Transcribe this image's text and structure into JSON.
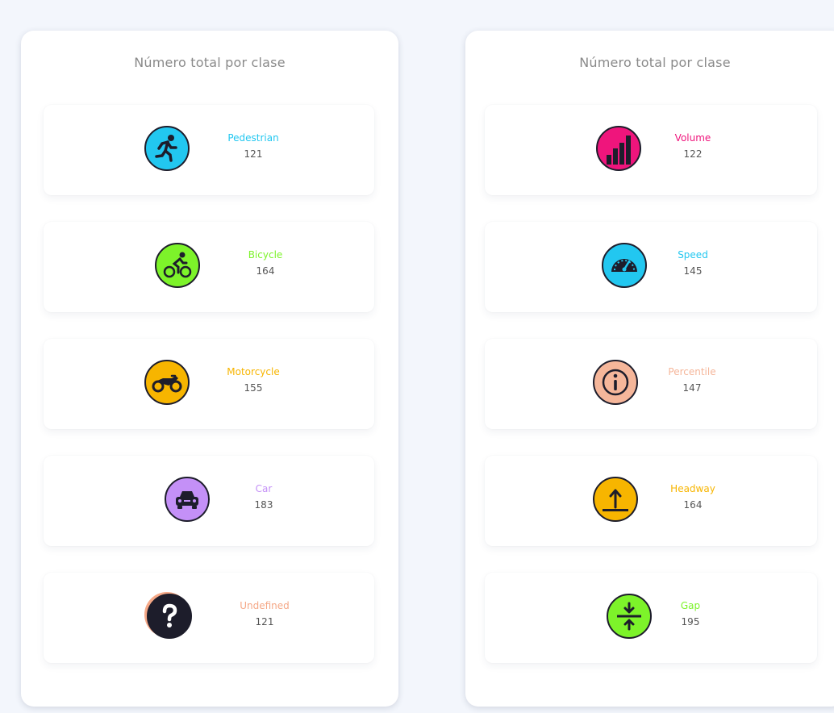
{
  "left_panel": {
    "title": "Número total por clase",
    "items": [
      {
        "label": "Pedestrian",
        "count": "121",
        "color": "#22c7f0",
        "icon": "running-person-icon"
      },
      {
        "label": "Bicycle",
        "count": "164",
        "color": "#7df32a",
        "icon": "cyclist-icon"
      },
      {
        "label": "Motorcycle",
        "count": "155",
        "color": "#f7b500",
        "icon": "motorcycle-icon"
      },
      {
        "label": "Car",
        "count": "183",
        "color": "#c490f7",
        "icon": "car-icon"
      },
      {
        "label": "Undefined",
        "count": "121",
        "color": "#f5a887",
        "icon": "question-mark-icon"
      }
    ]
  },
  "right_panel": {
    "title": "Número total por clase",
    "items": [
      {
        "label": "Volume",
        "count": "122",
        "color": "#ef157c",
        "icon": "bar-chart-icon"
      },
      {
        "label": "Speed",
        "count": "145",
        "color": "#22c7f0",
        "icon": "speedometer-icon"
      },
      {
        "label": "Percentile",
        "count": "147",
        "color": "#f5b69a",
        "icon": "info-icon"
      },
      {
        "label": "Headway",
        "count": "164",
        "color": "#f7b500",
        "icon": "arrow-up-line-icon"
      },
      {
        "label": "Gap",
        "count": "195",
        "color": "#7df32a",
        "icon": "compress-arrows-icon"
      }
    ]
  }
}
